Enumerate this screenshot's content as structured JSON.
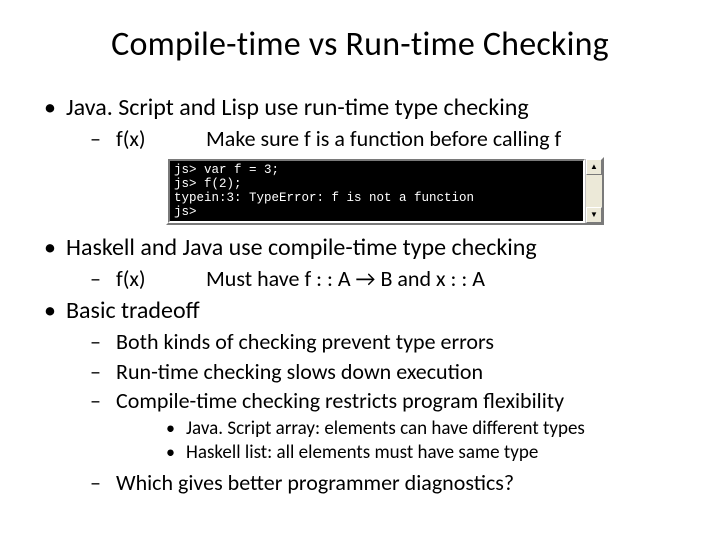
{
  "title": "Compile-time vs Run-time Checking",
  "b1": {
    "text": "Java. Script and Lisp use run-time type checking",
    "sub": {
      "fx": "f(x)",
      "desc": "Make sure f is a function before  calling f"
    }
  },
  "terminal": {
    "l1": "js> var f = 3;",
    "l2": "js> f(2);",
    "l3": "typein:3: TypeError: f is not a function",
    "l4": "js>"
  },
  "b2": {
    "text": "Haskell and Java use compile-time type checking",
    "sub": {
      "fx": "f(x)",
      "desc": "Must have f : : A → B and x : : A"
    }
  },
  "b3": {
    "text": "Basic tradeoff",
    "s1": "Both kinds of checking prevent type errors",
    "s2": "Run-time checking slows down execution",
    "s3": "Compile-time checking restricts program flexibility",
    "ss1": "Java. Script array: elements can have different types",
    "ss2": "Haskell list: all elements must have same type",
    "s4": "Which gives better programmer diagnostics?"
  }
}
